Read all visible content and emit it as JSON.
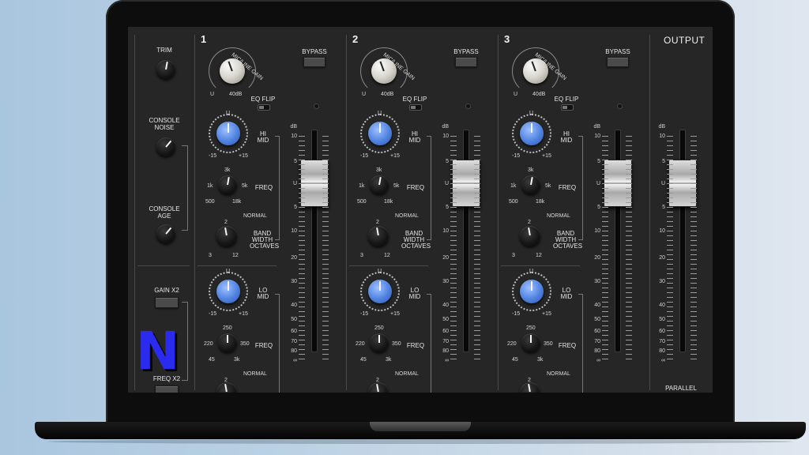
{
  "left_panel": {
    "trim_label": "TRIM",
    "console_noise_label": "CONSOLE\nNOISE",
    "console_age_label": "CONSOLE\nAGE",
    "gain_x2_label": "GAIN X2",
    "freq_x2_label": "FREQ X2"
  },
  "channels": [
    {
      "number": "1"
    },
    {
      "number": "2"
    },
    {
      "number": "3"
    }
  ],
  "channel_labels": {
    "bypass": "BYPASS",
    "mic_line_gain": "MIC/LINE GAIN",
    "gain_u": "U",
    "gain_40db": "40dB",
    "eq_flip": "EQ FLIP",
    "hi_mid": "HI\nMID",
    "lo_mid": "LO\nMID",
    "freq": "FREQ",
    "band_width": "BAND\nWIDTH\nOCTAVES",
    "normal": "NORMAL",
    "u": "U",
    "minus15": "-15",
    "plus15": "+15",
    "hi_f_top": "3k",
    "hi_f_left": "1k",
    "hi_f_right": "5k",
    "hi_f_bl": "500",
    "hi_f_br": "18k",
    "lo_f_top": "250",
    "lo_f_left": "220",
    "lo_f_right": "350",
    "lo_f_bl": "45",
    "lo_f_br": "3k",
    "bw_top": "2",
    "bw_bl": "3",
    "bw_br": "12"
  },
  "fader_scale": [
    "dB",
    "10",
    "5",
    "U",
    "5",
    "10",
    "20",
    "30",
    "40",
    "50",
    "60",
    "70",
    "80",
    "∞"
  ],
  "output": {
    "title": "OUTPUT",
    "parallel_label": "PARALLEL"
  },
  "logo_text": "N"
}
